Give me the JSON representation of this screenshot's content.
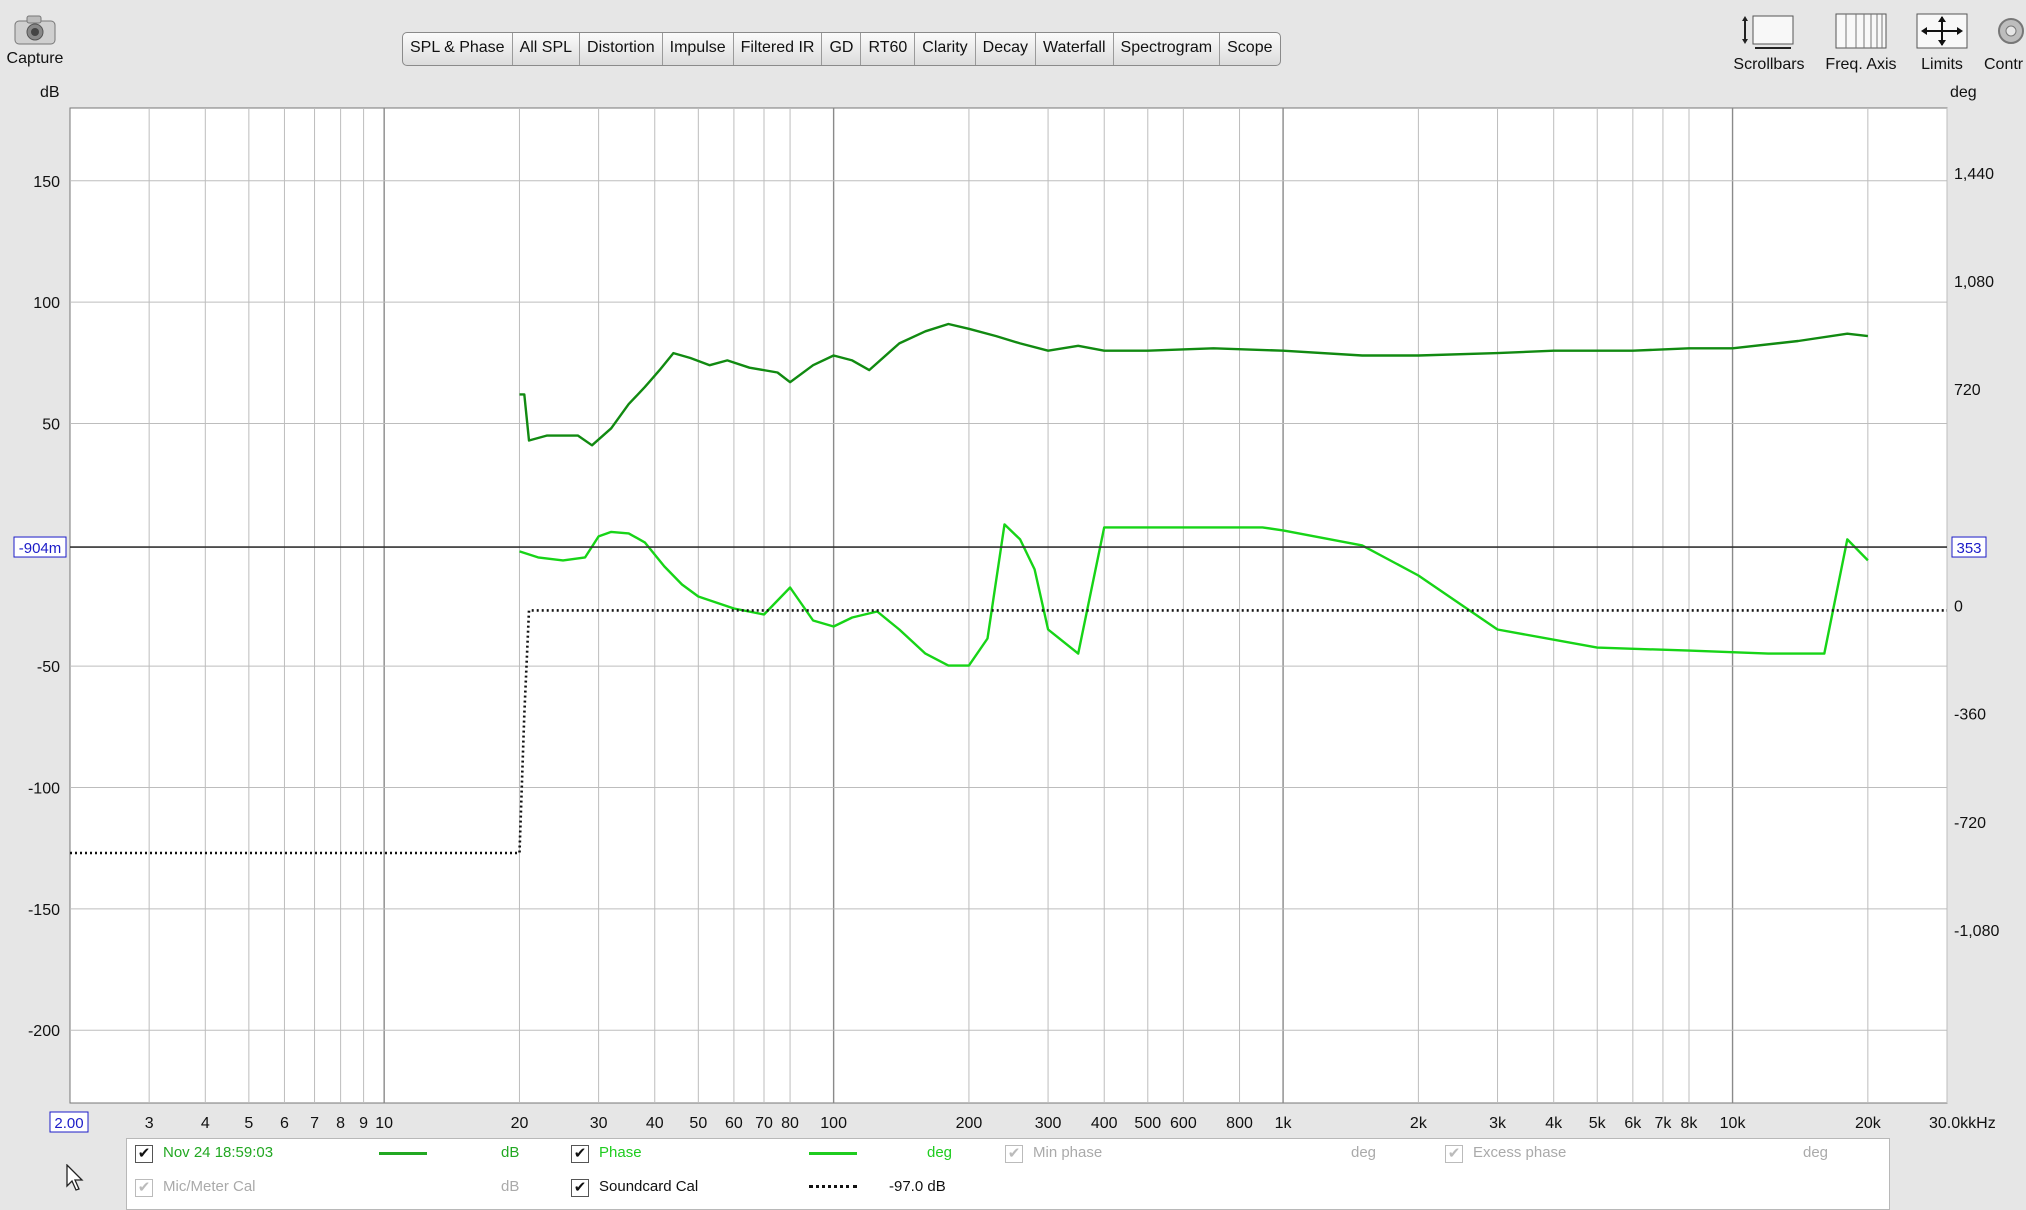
{
  "toolbar": {
    "capture_label": "Capture",
    "tabs": [
      {
        "label": "SPL & Phase",
        "active": true
      },
      {
        "label": "All SPL"
      },
      {
        "label": "Distortion"
      },
      {
        "label": "Impulse"
      },
      {
        "label": "Filtered IR"
      },
      {
        "label": "GD"
      },
      {
        "label": "RT60"
      },
      {
        "label": "Clarity"
      },
      {
        "label": "Decay"
      },
      {
        "label": "Waterfall"
      },
      {
        "label": "Spectrogram"
      },
      {
        "label": "Scope"
      }
    ],
    "right_tools": [
      {
        "label": "Scrollbars",
        "icon": "scrollbars-icon"
      },
      {
        "label": "Freq. Axis",
        "icon": "freq-axis-icon"
      },
      {
        "label": "Limits",
        "icon": "limits-icon"
      },
      {
        "label": "Contr",
        "icon": "controls-gear-icon"
      }
    ]
  },
  "axes": {
    "left_unit": "dB",
    "right_unit": "deg",
    "freq_unit_suffix": "kHz"
  },
  "chart_data": {
    "type": "line",
    "x_scale": "log",
    "xlim": [
      2.0,
      30000
    ],
    "ylim": [
      -230,
      180
    ],
    "y2lim": [
      -1656,
      1656
    ],
    "grid": true,
    "y_ticks": [
      "150",
      "100",
      "50",
      "-50",
      "-100",
      "-150",
      "-200"
    ],
    "y_tick_values": [
      150,
      100,
      50,
      -50,
      -100,
      -150,
      -200
    ],
    "y2_ticks": [
      "1,440",
      "1,080",
      "720",
      "0",
      "-360",
      "-720",
      "-1,080"
    ],
    "y2_tick_values": [
      1440,
      1080,
      720,
      0,
      -360,
      -720,
      -1080
    ],
    "x_ticks": [
      "3",
      "4",
      "5",
      "6",
      "7",
      "8",
      "9",
      "10",
      "20",
      "30",
      "40",
      "50",
      "60",
      "70",
      "80",
      "100",
      "200",
      "300",
      "400",
      "500",
      "600",
      "800",
      "1k",
      "2k",
      "3k",
      "4k",
      "5k",
      "6k",
      "7k",
      "8k",
      "10k",
      "20k",
      "30.0k"
    ],
    "x_tick_values": [
      3,
      4,
      5,
      6,
      7,
      8,
      9,
      10,
      20,
      30,
      40,
      50,
      60,
      70,
      80,
      100,
      200,
      300,
      400,
      500,
      600,
      800,
      1000,
      2000,
      3000,
      4000,
      5000,
      6000,
      7000,
      8000,
      10000,
      20000,
      30000
    ],
    "x_start_label": "2.00",
    "cursor_left_label": "-904m",
    "cursor_right_label": "353",
    "cursor_y": -0.904,
    "series": [
      {
        "name": "Nov 24 18:59:03",
        "unit": "dB",
        "color": "#118a11",
        "style": "solid",
        "x": [
          20,
          20.5,
          21,
          23,
          27,
          29,
          32,
          35,
          38,
          41,
          44,
          48,
          53,
          58,
          65,
          75,
          80,
          90,
          100,
          110,
          120,
          140,
          160,
          180,
          200,
          230,
          260,
          300,
          350,
          400,
          500,
          700,
          1000,
          1500,
          2000,
          3000,
          4000,
          6000,
          8000,
          10000,
          14000,
          18000,
          20000
        ],
        "y": [
          62,
          62,
          43,
          45,
          45,
          41,
          48,
          58,
          65,
          72,
          79,
          77,
          74,
          76,
          73,
          71,
          67,
          74,
          78,
          76,
          72,
          83,
          88,
          91,
          89,
          86,
          83,
          80,
          82,
          80,
          80,
          81,
          80,
          78,
          78,
          79,
          80,
          80,
          81,
          81,
          84,
          87,
          86
        ]
      },
      {
        "name": "Phase",
        "unit": "deg",
        "color": "#17d417",
        "style": "solid",
        "x": [
          20,
          22,
          25,
          28,
          30,
          32,
          35,
          38,
          42,
          46,
          50,
          60,
          70,
          80,
          90,
          100,
          110,
          125,
          140,
          160,
          180,
          200,
          220,
          240,
          260,
          280,
          300,
          350,
          400,
          600,
          900,
          1000,
          1500,
          2000,
          3000,
          5000,
          8000,
          12000,
          16000,
          18000,
          20000
        ],
        "y": [
          180,
          160,
          150,
          160,
          230,
          245,
          240,
          210,
          130,
          70,
          30,
          -10,
          -30,
          60,
          -50,
          -70,
          -40,
          -20,
          -80,
          -160,
          -200,
          -200,
          -110,
          270,
          220,
          120,
          -80,
          -160,
          260,
          260,
          260,
          250,
          200,
          100,
          -80,
          -140,
          -150,
          -160,
          -160,
          220,
          150
        ]
      },
      {
        "name": "Soundcard Cal",
        "value_text": "-97.0 dB",
        "color": "#111111",
        "style": "dotted",
        "x": [
          2,
          20,
          20.5,
          21,
          30000
        ],
        "y": [
          -127,
          -127,
          -70,
          -27,
          -27
        ]
      }
    ]
  },
  "legend": {
    "items": [
      {
        "label": "Nov 24 18:59:03",
        "unit": "dB",
        "checked": true,
        "enabled": true,
        "color": "#22a822"
      },
      {
        "label": "Phase",
        "unit": "deg",
        "checked": true,
        "enabled": true,
        "color": "#1fcc1f"
      },
      {
        "label": "Min phase",
        "unit": "deg",
        "checked": true,
        "enabled": false,
        "color": "#aaaaaa"
      },
      {
        "label": "Excess phase",
        "unit": "deg",
        "checked": true,
        "enabled": false,
        "color": "#aaaaaa"
      },
      {
        "label": "Mic/Meter Cal",
        "unit": "dB",
        "checked": true,
        "enabled": false,
        "color": "#aaaaaa"
      },
      {
        "label": "Soundcard Cal",
        "unit": "-97.0 dB",
        "checked": true,
        "enabled": true,
        "color": "#111111"
      }
    ]
  }
}
